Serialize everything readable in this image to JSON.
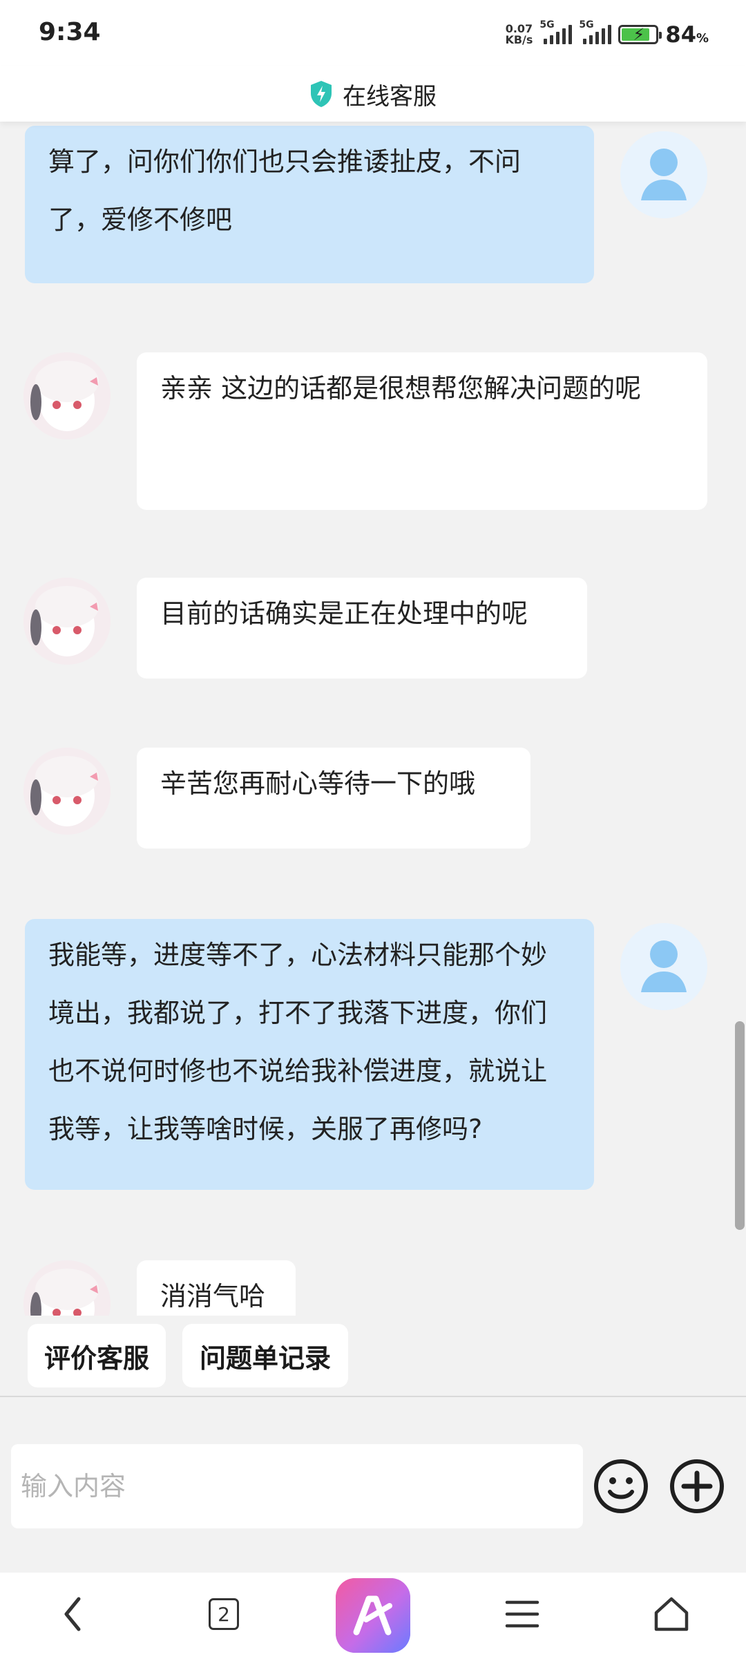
{
  "status_bar": {
    "time": "9:34",
    "net_speed_value": "0.07",
    "net_speed_unit": "KB/s",
    "signal_1_label": "5G",
    "signal_2_label": "5G",
    "battery_percent": "84",
    "battery_unit": "%",
    "battery_level": 0.84
  },
  "header": {
    "title": "在线客服",
    "icon": "shield-bolt-icon",
    "accent": "#2ec4b6"
  },
  "messages": [
    {
      "from": "user",
      "text": "算了，问你们你们也只会推诿扯皮，不问了，爱修不修吧"
    },
    {
      "from": "agent",
      "text": "亲亲 这边的话都是很想帮您解决问题的呢"
    },
    {
      "from": "agent",
      "text": "目前的话确实是正在处理中的呢"
    },
    {
      "from": "agent",
      "text": "辛苦您再耐心等待一下的哦"
    },
    {
      "from": "user",
      "text": "我能等，进度等不了，心法材料只能那个妙境出，我都说了，打不了我落下进度，你们也不说何时修也不说给我补偿进度，就说让我等，让我等啥时候，关服了再修吗?"
    },
    {
      "from": "agent",
      "text": "消消气哈"
    }
  ],
  "quick_actions": [
    {
      "label": "评价客服"
    },
    {
      "label": "问题单记录"
    }
  ],
  "input": {
    "placeholder": "输入内容",
    "value": ""
  },
  "input_icons": [
    "emoji-icon",
    "plus-icon"
  ],
  "nav": {
    "tab_count": "2",
    "icons": [
      "back-icon",
      "tabs-icon",
      "app-logo-icon",
      "menu-icon",
      "home-icon"
    ]
  },
  "colors": {
    "user_bubble": "#cce6fb",
    "agent_bubble": "#ffffff",
    "background": "#f2f2f2",
    "user_avatar": "#8cc8f4"
  }
}
